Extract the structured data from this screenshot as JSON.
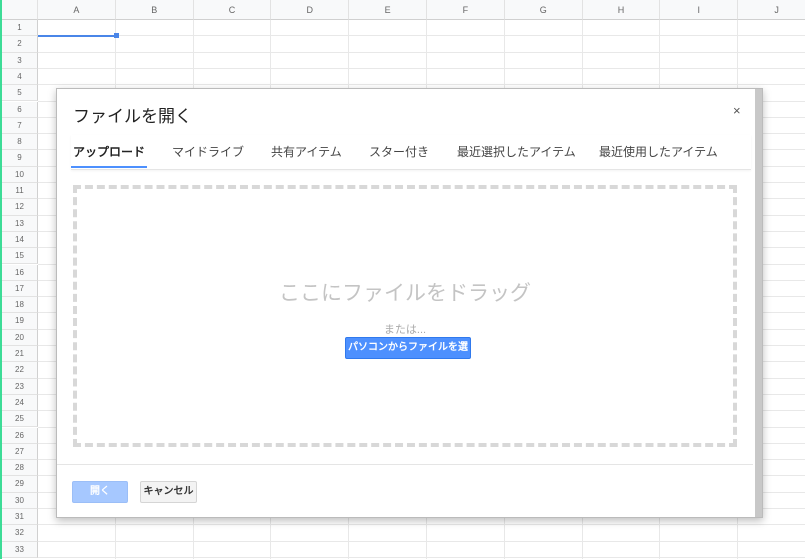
{
  "sheet": {
    "columns": [
      "A",
      "B",
      "C",
      "D",
      "E",
      "F",
      "G",
      "H",
      "I",
      "J"
    ],
    "rows": [
      "1",
      "2",
      "3",
      "4",
      "5",
      "6",
      "7",
      "8",
      "9",
      "10",
      "11",
      "12",
      "13",
      "14",
      "15",
      "16",
      "17",
      "18",
      "19",
      "20",
      "21",
      "22",
      "23",
      "24",
      "25",
      "26",
      "27",
      "28",
      "29",
      "30",
      "31",
      "32",
      "33"
    ],
    "selected_cell": "A1"
  },
  "dialog": {
    "title": "ファイルを開く",
    "close": "×",
    "tabs": [
      {
        "label": "アップロード",
        "active": true
      },
      {
        "label": "マイドライブ"
      },
      {
        "label": "共有アイテム"
      },
      {
        "label": "スター付き"
      },
      {
        "label": "最近選択したアイテム"
      },
      {
        "label": "最近使用したアイテム"
      }
    ],
    "drop_text": "ここにファイルをドラッグ",
    "or_text": "または...",
    "select_button": "パソコンからファイルを選択",
    "open_button": "開く",
    "cancel_button": "キャンセル"
  },
  "colors": {
    "accent": "#4d90fe",
    "open_disabled": "#a6c8ff"
  }
}
